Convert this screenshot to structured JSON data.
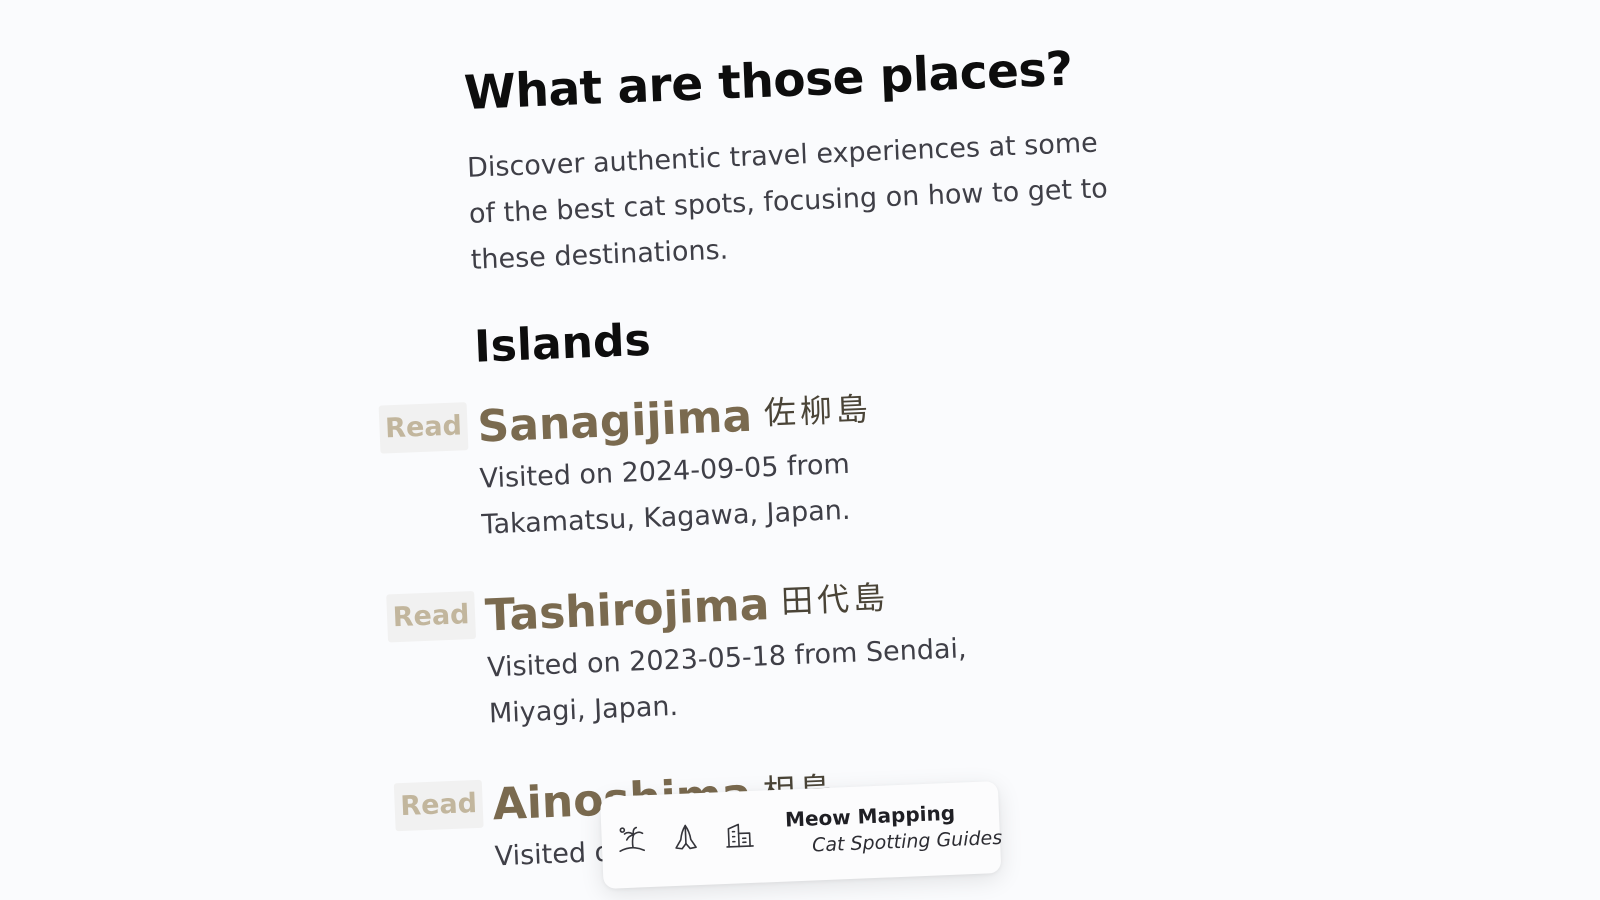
{
  "page": {
    "title": "What are those places?",
    "intro": "Discover authentic travel experiences at some of the best cat spots, focusing on how to get to these destinations."
  },
  "sections": [
    {
      "title": "Islands",
      "entries": [
        {
          "read_label": "Read",
          "name": "Sanagijima",
          "jp_name": "佐柳島",
          "description": "Visited on 2024-09-05 from Takamatsu, Kagawa, Japan."
        },
        {
          "read_label": "Read",
          "name": "Tashirojima",
          "jp_name": "田代島",
          "description": "Visited on 2023-05-18 from Sendai, Miyagi, Japan."
        },
        {
          "read_label": "Read",
          "name": "Ainoshima",
          "jp_name": "相島",
          "description": "Visited on ... Fukuoka, ..."
        }
      ]
    }
  ],
  "dock": {
    "icons": [
      "palm-tree-island-icon",
      "shrine-hands-icon",
      "city-buildings-icon"
    ],
    "brand_name": "Meow Mapping",
    "brand_tagline": "Cat Spotting Guides"
  },
  "colors": {
    "background": "#fafbfd",
    "heading": "#0d0d0d",
    "entry_title": "#7a6a4f",
    "read_badge_text": "#c2b69d",
    "read_badge_bg": "#f1f1f1",
    "body_text": "#3f3f47"
  }
}
